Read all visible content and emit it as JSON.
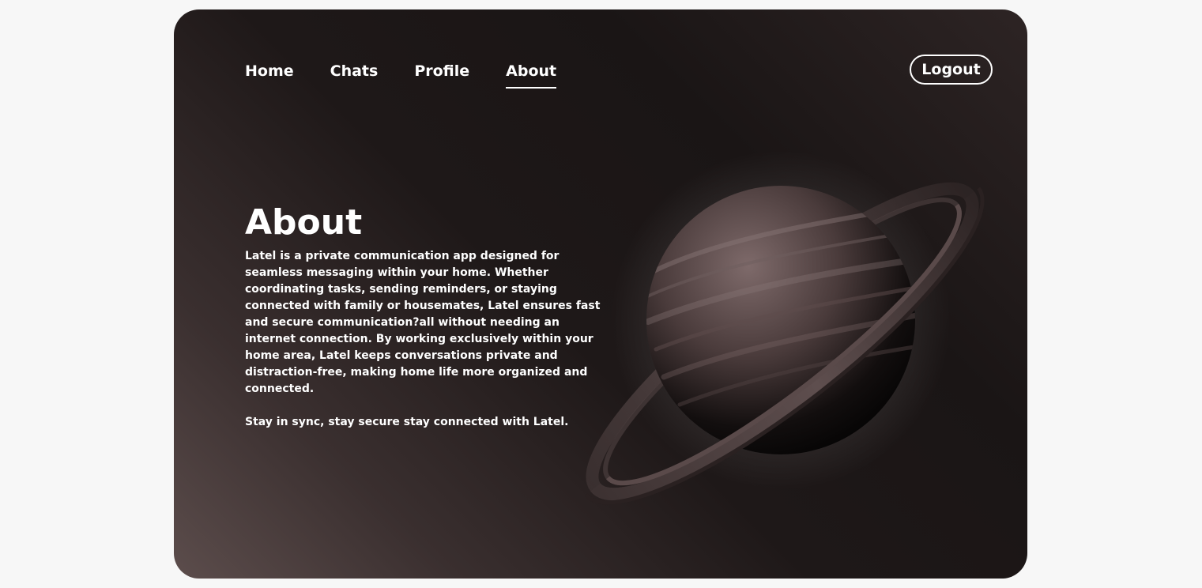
{
  "nav": {
    "items": [
      {
        "label": "Home",
        "active": false
      },
      {
        "label": "Chats",
        "active": false
      },
      {
        "label": "Profile",
        "active": false
      },
      {
        "label": "About",
        "active": true
      }
    ],
    "logout_label": "Logout"
  },
  "about": {
    "title": "About",
    "paragraph1": "Latel is a private communication app designed for seamless messaging within your home. Whether coordinating tasks, sending reminders, or staying connected with family or housemates, Latel ensures fast and secure communication?all without needing an internet connection. By working exclusively within your home area, Latel keeps conversations private and distraction-free, making home life more organized and connected.",
    "paragraph2": "Stay in sync, stay secure stay connected with Latel."
  },
  "illustration": {
    "icon": "saturn-planet-illustration"
  },
  "colors": {
    "page_background": "#f7f7f7",
    "card_dark": "#1a1515",
    "card_light": "#5c4d4c",
    "text": "#ffffff"
  }
}
